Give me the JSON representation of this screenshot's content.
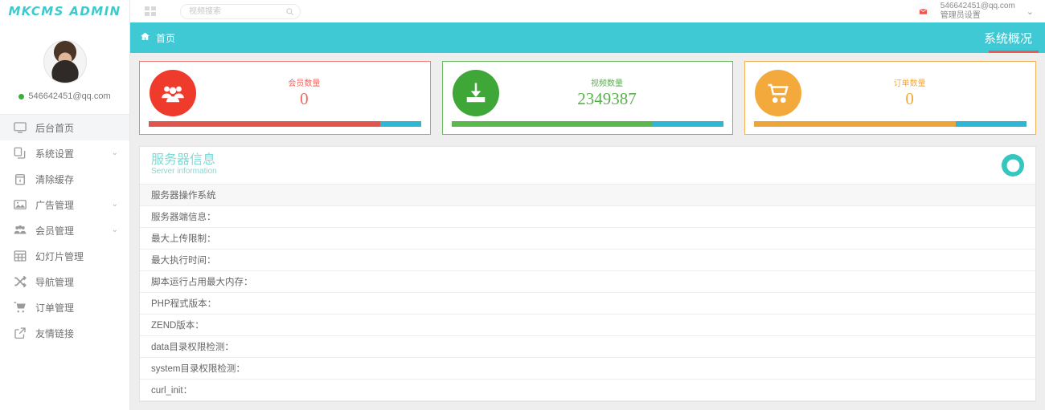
{
  "brand": {
    "logo_text": "MKCMS ADMIN"
  },
  "sidebar": {
    "user_email": "546642451@qq.com",
    "items": [
      {
        "label": "后台首页",
        "icon": "monitor-icon",
        "caret": "",
        "active": true
      },
      {
        "label": "系统设置",
        "icon": "settings-copy-icon",
        "caret": "⌄",
        "active": false
      },
      {
        "label": "清除缓存",
        "icon": "trash-icon",
        "caret": "",
        "active": false
      },
      {
        "label": "广告管理",
        "icon": "image-icon",
        "caret": "⌄",
        "active": false
      },
      {
        "label": "会员管理",
        "icon": "users-icon",
        "caret": "⌄",
        "active": false
      },
      {
        "label": "幻灯片管理",
        "icon": "table-icon",
        "caret": "",
        "active": false
      },
      {
        "label": "导航管理",
        "icon": "shuffle-icon",
        "caret": "",
        "active": false
      },
      {
        "label": "订单管理",
        "icon": "cart-icon",
        "caret": "",
        "active": false
      },
      {
        "label": "友情链接",
        "icon": "external-link-icon",
        "caret": "",
        "active": false
      }
    ]
  },
  "topbar": {
    "grid_icon": "grid-icon",
    "search": {
      "value": "",
      "placeholder": "视频搜索",
      "icon": "search-icon"
    },
    "mail_icon": "envelope-icon",
    "account_email": "546642451@qq.com",
    "account_role": "管理员设置",
    "caret": "⌄"
  },
  "breadcrumb": {
    "home_icon": "home-icon",
    "home_label": "首页",
    "active_tab": "系统概况"
  },
  "cards": [
    {
      "label": "会员数量",
      "value": "0",
      "color": "#ef3b2c",
      "icon": "users-group-icon",
      "fill_pct": 85
    },
    {
      "label": "视频数量",
      "value": "2349387",
      "color": "#3fa638",
      "icon": "download-icon",
      "fill_pct": 74
    },
    {
      "label": "订单数量",
      "value": "0",
      "color": "#f3a93c",
      "icon": "cart-icon",
      "fill_pct": 74
    }
  ],
  "panel": {
    "title_cn": "服务器信息",
    "title_en": "Server information",
    "globe_icon": "globe-icon",
    "rows": [
      {
        "label": "服务器操作系统",
        "badge": "",
        "badge_color": "green",
        "striped": true
      },
      {
        "label": "服务器端信息：",
        "badge": "",
        "badge_color": "orange",
        "striped": false
      },
      {
        "label": "最大上传限制：",
        "badge": "",
        "badge_color": "red",
        "striped": false
      },
      {
        "label": "最大执行时间：",
        "badge": "",
        "badge_color": "green",
        "striped": false
      },
      {
        "label": "脚本运行占用最大内存：",
        "badge": "",
        "badge_color": "orange",
        "striped": false
      },
      {
        "label": "PHP程式版本：",
        "badge": "",
        "badge_color": "red",
        "striped": false
      },
      {
        "label": "ZEND版本：",
        "badge": "",
        "badge_color": "green",
        "striped": false
      },
      {
        "label": "data目录权限检测：",
        "badge": "",
        "badge_color": "orange",
        "striped": false
      },
      {
        "label": "system目录权限检测：",
        "badge": "",
        "badge_color": "red",
        "striped": false
      },
      {
        "label": "curl_init：",
        "badge": "",
        "badge_color": "green",
        "striped": false
      }
    ]
  }
}
